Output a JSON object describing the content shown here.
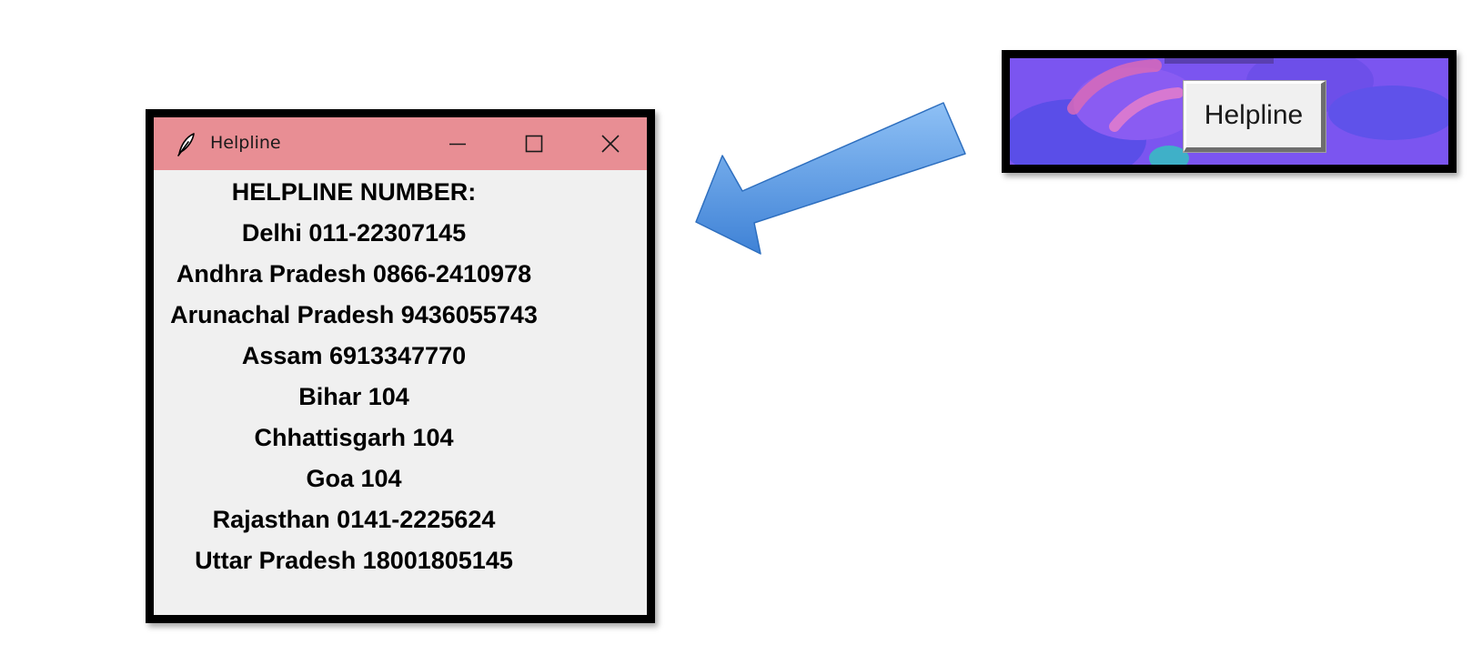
{
  "window": {
    "title": "Helpline",
    "title_bar_color": "#e88e94",
    "icon": "feather-icon",
    "controls": [
      "minimize-icon",
      "maximize-icon",
      "close-icon"
    ]
  },
  "content": {
    "heading": "HELPLINE NUMBER:",
    "entries": [
      "Delhi 011-22307145",
      "Andhra Pradesh 0866-2410978",
      "Arunachal Pradesh 9436055743",
      "Assam 6913347770",
      "Bihar 104",
      "Chhattisgarh 104",
      "Goa 104",
      "Rajasthan 0141-2225624",
      "Uttar Pradesh 18001805145"
    ]
  },
  "button_snippet": {
    "button_label": "Helpline",
    "background_color": "#7b55f0"
  },
  "arrow": {
    "color": "#5b9be0",
    "icon": "left-arrow-icon"
  }
}
